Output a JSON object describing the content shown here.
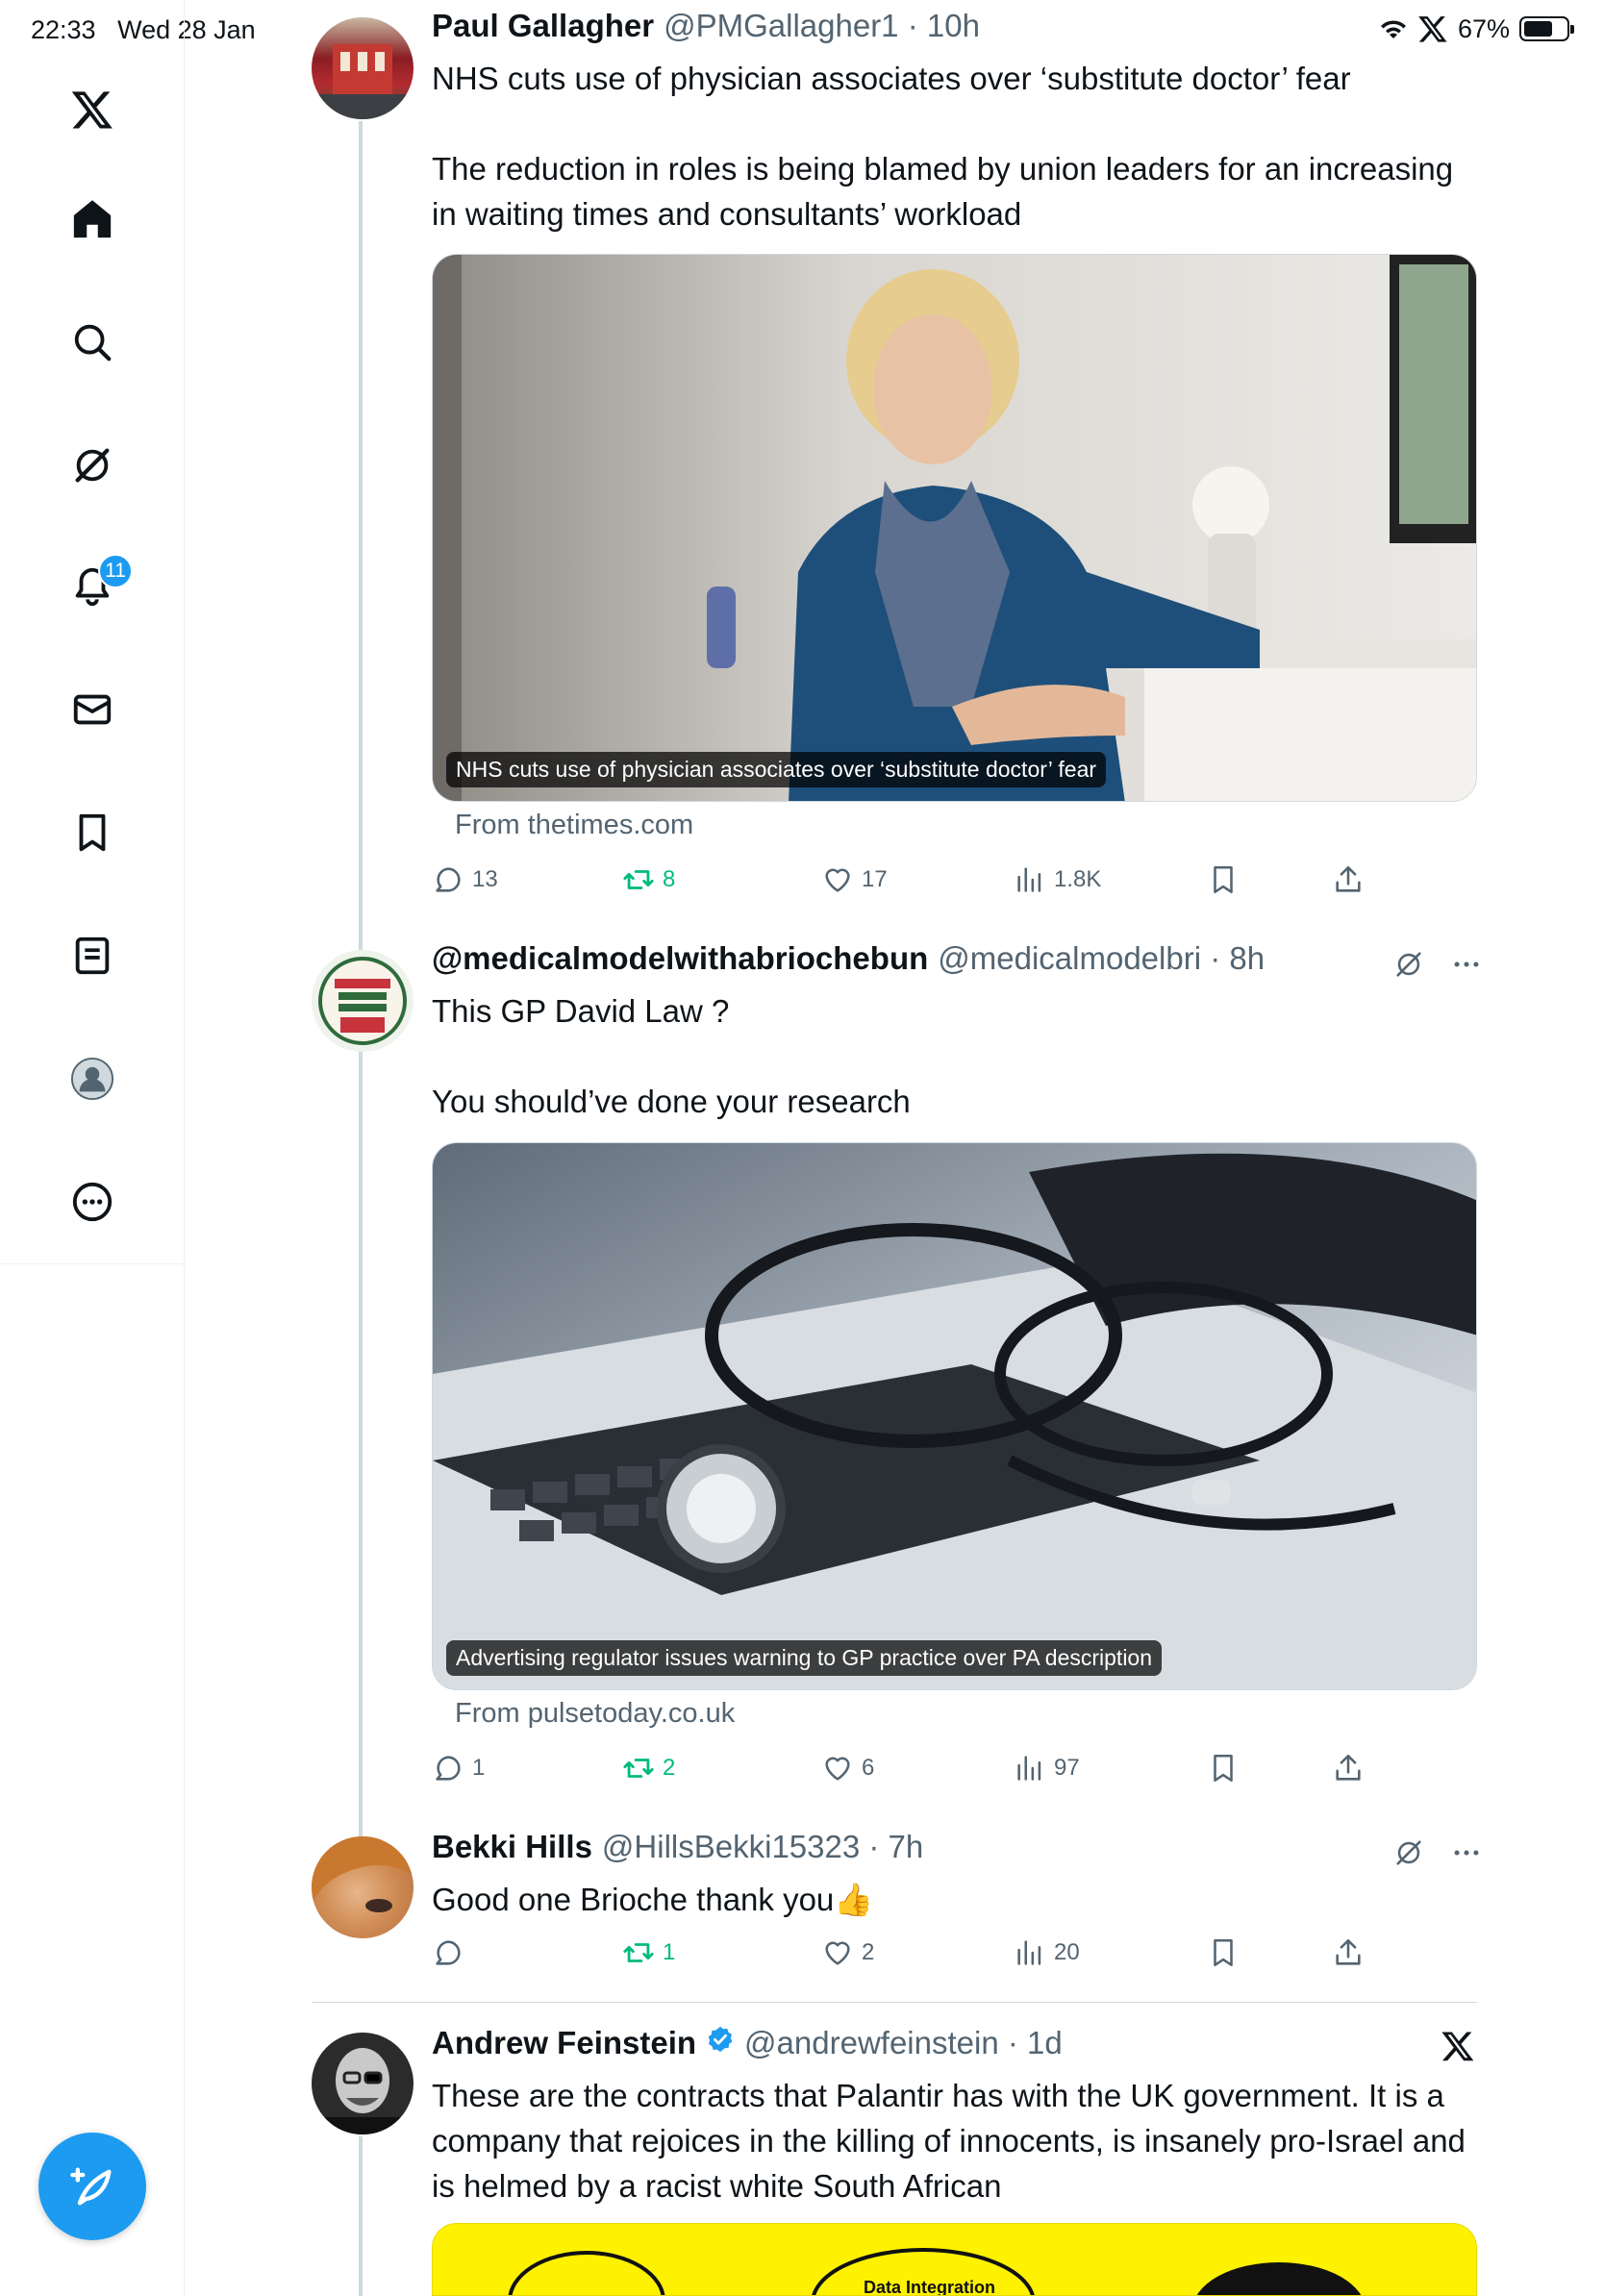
{
  "status_bar": {
    "time": "22:33",
    "date": "Wed 28 Jan",
    "battery_text": "67%"
  },
  "nav": {
    "notifications_badge": "11"
  },
  "tweets": [
    {
      "name": "Paul Gallagher",
      "handle": "@PMGallagher1",
      "time": "10h",
      "text1": "NHS cuts use of physician associates over ‘substitute doctor’ fear",
      "text2": "The reduction in roles is being blamed by union leaders for an increasing in waiting times and consultants’ workload",
      "card_caption": "NHS cuts use of physician associates over ‘substitute doctor’ fear",
      "card_source": "From thetimes.com",
      "replies": "13",
      "retweets": "8",
      "likes": "17",
      "views": "1.8K"
    },
    {
      "name": "@medicalmodelwithabriochebun",
      "handle": "@medicalmodelbri",
      "time": "8h",
      "text1": "This GP David Law ?",
      "text2": "You should’ve done your research",
      "card_caption": "Advertising regulator issues warning to GP practice over PA description",
      "card_source": "From pulsetoday.co.uk",
      "replies": "1",
      "retweets": "2",
      "likes": "6",
      "views": "97"
    },
    {
      "name": "Bekki Hills",
      "handle": "@HillsBekki15323",
      "time": "7h",
      "text1": "Good one Brioche thank you👍",
      "replies": "",
      "retweets": "1",
      "likes": "2",
      "views": "20"
    },
    {
      "name": "Andrew Feinstein",
      "handle": "@andrewfeinstein",
      "time": "1d",
      "text1": "These are the contracts that Palantir has with the UK government. It is a company that rejoices in the killing of innocents, is insanely pro-Israel and is helmed by a racist white South African",
      "card_label": "Data Integration"
    }
  ],
  "colors": {
    "accent": "#1d9bf0",
    "retweet": "#00ba7c",
    "muted": "#536471",
    "text": "#0f1419"
  }
}
